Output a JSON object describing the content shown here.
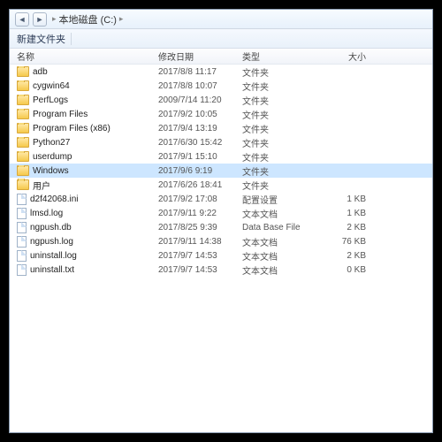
{
  "breadcrumb": {
    "sep": "▸",
    "drive": "本地磁盘 (C:)",
    "suffix": "▸"
  },
  "toolbar": {
    "new_folder": "新建文件夹"
  },
  "columns": {
    "name": "名称",
    "modified": "修改日期",
    "type": "类型",
    "size": "大小"
  },
  "rows": [
    {
      "icon": "folder",
      "name": "adb",
      "date": "2017/8/8 11:17",
      "type": "文件夹",
      "size": "",
      "selected": false
    },
    {
      "icon": "folder",
      "name": "cygwin64",
      "date": "2017/8/8 10:07",
      "type": "文件夹",
      "size": "",
      "selected": false
    },
    {
      "icon": "folder",
      "name": "PerfLogs",
      "date": "2009/7/14 11:20",
      "type": "文件夹",
      "size": "",
      "selected": false
    },
    {
      "icon": "folder",
      "name": "Program Files",
      "date": "2017/9/2 10:05",
      "type": "文件夹",
      "size": "",
      "selected": false
    },
    {
      "icon": "folder",
      "name": "Program Files (x86)",
      "date": "2017/9/4 13:19",
      "type": "文件夹",
      "size": "",
      "selected": false
    },
    {
      "icon": "folder",
      "name": "Python27",
      "date": "2017/6/30 15:42",
      "type": "文件夹",
      "size": "",
      "selected": false
    },
    {
      "icon": "folder",
      "name": "userdump",
      "date": "2017/9/1 15:10",
      "type": "文件夹",
      "size": "",
      "selected": false
    },
    {
      "icon": "folder",
      "name": "Windows",
      "date": "2017/9/6 9:19",
      "type": "文件夹",
      "size": "",
      "selected": true
    },
    {
      "icon": "folder",
      "name": "用户",
      "date": "2017/6/26 18:41",
      "type": "文件夹",
      "size": "",
      "selected": false
    },
    {
      "icon": "ini",
      "name": "d2f42068.ini",
      "date": "2017/9/2 17:08",
      "type": "配置设置",
      "size": "1 KB",
      "selected": false
    },
    {
      "icon": "file",
      "name": "lmsd.log",
      "date": "2017/9/11 9:22",
      "type": "文本文档",
      "size": "1 KB",
      "selected": false
    },
    {
      "icon": "db",
      "name": "ngpush.db",
      "date": "2017/8/25 9:39",
      "type": "Data Base File",
      "size": "2 KB",
      "selected": false
    },
    {
      "icon": "log",
      "name": "ngpush.log",
      "date": "2017/9/11 14:38",
      "type": "文本文档",
      "size": "76 KB",
      "selected": false
    },
    {
      "icon": "log",
      "name": "uninstall.log",
      "date": "2017/9/7 14:53",
      "type": "文本文档",
      "size": "2 KB",
      "selected": false
    },
    {
      "icon": "txt",
      "name": "uninstall.txt",
      "date": "2017/9/7 14:53",
      "type": "文本文档",
      "size": "0 KB",
      "selected": false
    }
  ]
}
